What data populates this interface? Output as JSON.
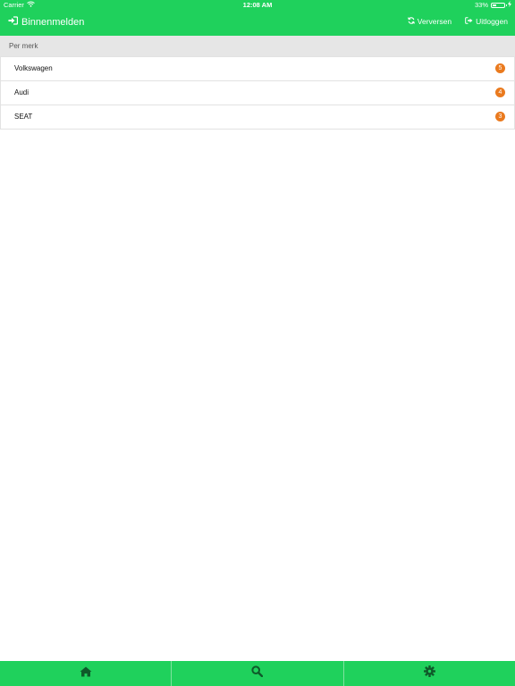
{
  "status_bar": {
    "carrier": "Carrier",
    "time": "12:08 AM",
    "battery": "33%",
    "battery_level": 0.33
  },
  "header": {
    "title": "Binnenmelden",
    "title_icon": "sign-in-icon",
    "actions": [
      {
        "label": "Verversen",
        "icon": "refresh-icon"
      },
      {
        "label": "Uitloggen",
        "icon": "sign-out-icon"
      }
    ]
  },
  "section": {
    "title": "Per merk"
  },
  "brands": [
    {
      "name": "Volkswagen",
      "count": "5"
    },
    {
      "name": "Audi",
      "count": "4"
    },
    {
      "name": "SEAT",
      "count": "3"
    }
  ],
  "tabbar": {
    "tabs": [
      {
        "icon": "home-icon"
      },
      {
        "icon": "search-icon"
      },
      {
        "icon": "gear-icon"
      }
    ]
  },
  "colors": {
    "primary_green": "#1fd15c",
    "badge_orange": "#ea7a1e",
    "section_gray": "#e6e6e6",
    "tab_icon_dark": "#0f5a2a"
  }
}
